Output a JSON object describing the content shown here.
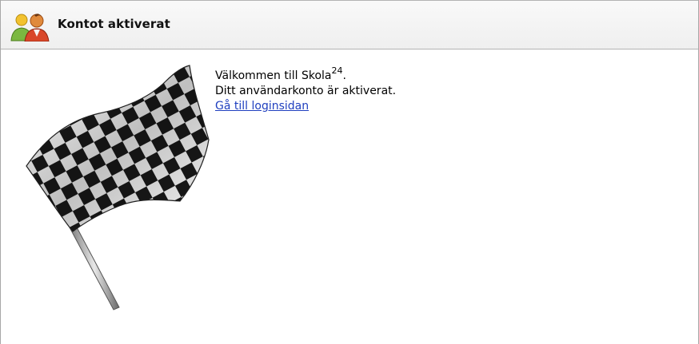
{
  "header": {
    "title": "Kontot aktiverat",
    "icon": "users-icon"
  },
  "content": {
    "welcome_prefix": "Välkommen till Skola",
    "welcome_superscript": "24",
    "welcome_suffix": ".",
    "activated_text": "Ditt användarkonto är aktiverat.",
    "login_link": "Gå till loginsidan"
  },
  "illustration": {
    "icon": "checkered-flag-icon"
  },
  "colors": {
    "link": "#1f3fbf",
    "header_bg": "#f3f3f3",
    "border": "#a7a7a7"
  }
}
